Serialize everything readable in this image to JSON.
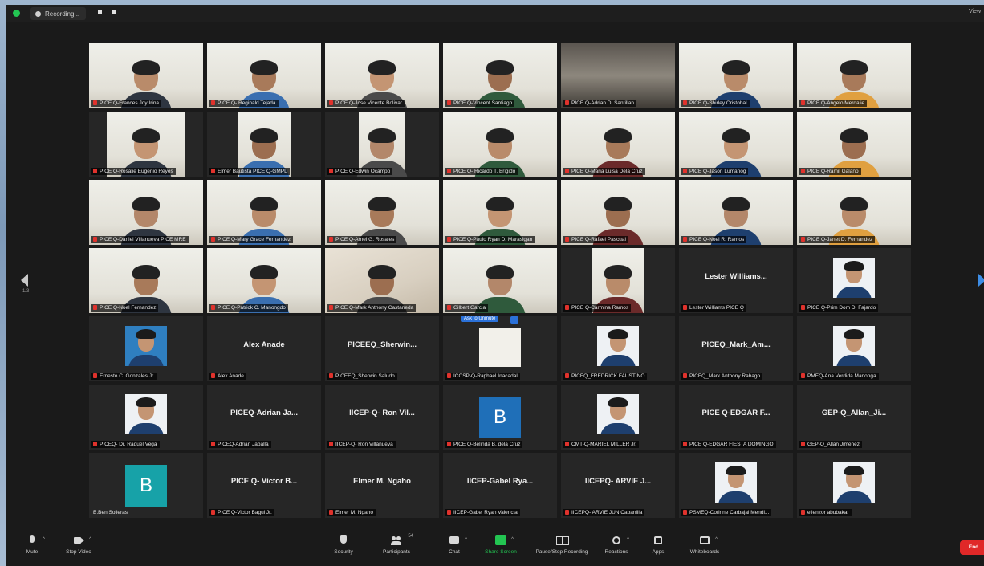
{
  "window": {
    "recording_label": "Recording...",
    "view_label": "View",
    "page_indicator": "1/3"
  },
  "participants": [
    {
      "name": "PICE Q-Frances Joy Irina",
      "kind": "video",
      "active": false
    },
    {
      "name": "PICE Q- Reginald Tejada",
      "kind": "video",
      "active": true
    },
    {
      "name": "PICE Q-Jose Vicente Bolivar",
      "kind": "video",
      "active": false
    },
    {
      "name": "PICE Q-Vincent Santiago",
      "kind": "video",
      "active": false
    },
    {
      "name": "PICE Q-Adrian D. Santillan",
      "kind": "video-dark",
      "active": false
    },
    {
      "name": "PICE Q-Shirley Cristobal",
      "kind": "video",
      "active": false
    },
    {
      "name": "PICE Q-Angelo Merdalie",
      "kind": "video",
      "active": false
    },
    {
      "name": "PICE Q-Rosalie Eugenio Reyes",
      "kind": "video-narrow",
      "active": false
    },
    {
      "name": "Elmer Bautista PICE Q-GMPL",
      "kind": "video-narrow2",
      "active": false
    },
    {
      "name": "PICE Q-Edwin Ocampo",
      "kind": "video-narrow3",
      "active": false
    },
    {
      "name": "PICE Q- Ricardo T. Brigido",
      "kind": "video",
      "active": false
    },
    {
      "name": "PICE Q-Maria Luisa Dela Cruz",
      "kind": "video",
      "active": false
    },
    {
      "name": "PICE Q-Jason Lumanog",
      "kind": "video",
      "active": false
    },
    {
      "name": "PICE Q-Ramil Galano",
      "kind": "video",
      "active": false
    },
    {
      "name": "PICE Q-Daniel Villanueva PICE MRE",
      "kind": "video",
      "active": false
    },
    {
      "name": "PICE Q-Mary Grace Fernandez",
      "kind": "video",
      "active": false
    },
    {
      "name": "PICE Q-Arnel G. Rosales",
      "kind": "video",
      "active": false
    },
    {
      "name": "PICE Q-Paulo Ryan D. Marasigan",
      "kind": "video",
      "active": false
    },
    {
      "name": "PICE Q-Rafael Pascual",
      "kind": "video",
      "active": false
    },
    {
      "name": "PICE Q-Noel R. Ramos",
      "kind": "video",
      "active": false
    },
    {
      "name": "PICE Q-Janet D. Fernandez",
      "kind": "video",
      "active": false
    },
    {
      "name": "PICE Q-Noel Fernandez",
      "kind": "video",
      "active": false
    },
    {
      "name": "PICE Q-Patrick C. Manongdo",
      "kind": "video",
      "active": false
    },
    {
      "name": "PICE Q-Mark Anthony Castaneda",
      "kind": "video-wall",
      "active": false
    },
    {
      "name": "Gilbert Garcia",
      "kind": "video",
      "active": false
    },
    {
      "name": "PICE Q-Carmina Ramos",
      "kind": "video-narrow2",
      "active": false
    },
    {
      "name": "Lester Williams PICE Q",
      "display": "Lester Williams...",
      "kind": "text",
      "active": false
    },
    {
      "name": "PICE Q-Prim Dom D. Fajardo",
      "kind": "photo",
      "active": false
    },
    {
      "name": "Ernesto C. Gonzales Jr.",
      "kind": "photo-blue",
      "active": false
    },
    {
      "name": "Alex Anade",
      "display": "Alex Anade",
      "kind": "text",
      "active": false
    },
    {
      "name": "PICEEQ_Sherwin Saludo",
      "display": "PICEEQ_Sherwin...",
      "kind": "text",
      "active": false
    },
    {
      "name": "ICCSP-Q-Raphael Inacadal",
      "kind": "blank",
      "active": false,
      "tooltip": "Ask to Unmute"
    },
    {
      "name": "PICEQ_FREDRICK FAUSTINO",
      "kind": "photo",
      "active": false
    },
    {
      "name": "PICEQ_Mark Anthony Rabago",
      "display": "PICEQ_Mark_Am...",
      "kind": "text",
      "active": false
    },
    {
      "name": "PMEQ-Ana Verdida Manonga",
      "kind": "photo",
      "active": false
    },
    {
      "name": "PICEQ- Dr. Raquel Vega",
      "kind": "photo",
      "active": false
    },
    {
      "name": "PICEQ-Adrian Jaballa",
      "display": "PICEQ-Adrian Ja...",
      "kind": "text",
      "active": false
    },
    {
      "name": "IICEP-Q- Ron Villanueva",
      "display": "IICEP-Q- Ron Vil...",
      "kind": "text",
      "active": false
    },
    {
      "name": "PICE Q-Belinda B. dela Cruz",
      "kind": "avatar",
      "letter": "B",
      "color": "#1f6fb8",
      "active": false
    },
    {
      "name": "CMT-Q-MARIEL MILLER Jr.",
      "kind": "photo",
      "active": false
    },
    {
      "name": "PICE Q-EDGAR FIESTA DOMINGO",
      "display": "PICE Q-EDGAR F...",
      "kind": "text",
      "active": false
    },
    {
      "name": "GEP-Q_Allan Jimenez",
      "display": "GEP-Q_Allan_Ji...",
      "kind": "text",
      "active": false
    },
    {
      "name": "B.Ben Solleras",
      "kind": "avatar",
      "letter": "B",
      "color": "#17a2a8",
      "active": false,
      "plain": true
    },
    {
      "name": "PICE Q-Victor Bagui Jr.",
      "display": "PICE Q- Victor B...",
      "kind": "text",
      "active": false
    },
    {
      "name": "Elmer M. Ngaho",
      "display": "Elmer M. Ngaho",
      "kind": "text",
      "active": false
    },
    {
      "name": "IICEP-Gabel Ryan Valencia",
      "display": "IICEP-Gabel Rya...",
      "kind": "text",
      "active": false
    },
    {
      "name": "IICEPQ- ARVIE JUN Cabanilla",
      "display": "IICEPQ- ARVIE J...",
      "kind": "text",
      "active": false
    },
    {
      "name": "PSMEQ-Corinne Carbajal Mendi...",
      "kind": "photo",
      "active": false
    },
    {
      "name": "ellenzor abubakar",
      "kind": "photo",
      "active": false
    }
  ],
  "toolbar": {
    "mute": "Mute",
    "stop_video": "Stop Video",
    "security": "Security",
    "participants": "Participants",
    "participants_count": "54",
    "chat": "Chat",
    "share_screen": "Share Screen",
    "pause_recording": "Pause/Stop Recording",
    "reactions": "Reactions",
    "apps": "Apps",
    "whiteboards": "Whiteboards",
    "end": "End"
  },
  "colors": {
    "active_speaker": "#b6d84a",
    "share_green": "#23c552",
    "end_red": "#e02828",
    "muted_red": "#e0322c"
  }
}
